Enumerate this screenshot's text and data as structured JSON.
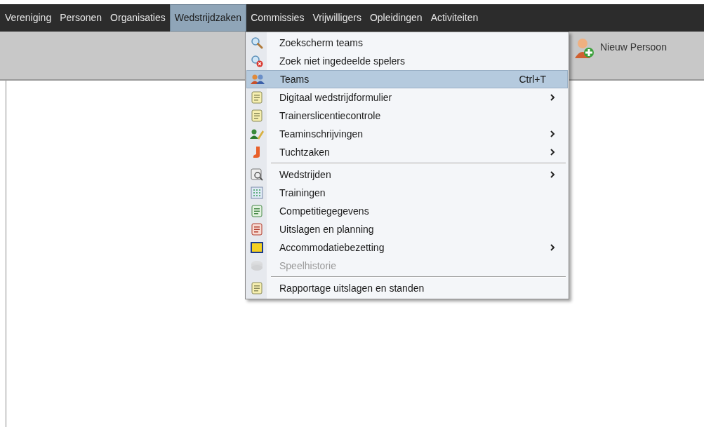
{
  "menu_bar": [
    {
      "label": "Vereniging",
      "selected": false
    },
    {
      "label": "Personen",
      "selected": false
    },
    {
      "label": "Organisaties",
      "selected": false
    },
    {
      "label": "Wedstrijdzaken",
      "selected": true
    },
    {
      "label": "Commissies",
      "selected": false
    },
    {
      "label": "Vrijwilligers",
      "selected": false
    },
    {
      "label": "Opleidingen",
      "selected": false
    },
    {
      "label": "Activiteiten",
      "selected": false
    }
  ],
  "toolbar": {
    "new_person_button": "Nieuw Persoon"
  },
  "dropdown": [
    {
      "kind": "item",
      "label": "Zoekscherm teams",
      "selected": false,
      "disabled": false,
      "submenu": false
    },
    {
      "kind": "item",
      "label": "Zoek niet ingedeelde spelers",
      "selected": false,
      "disabled": false,
      "submenu": false
    },
    {
      "kind": "item",
      "label": "Teams",
      "shortcut": "Ctrl+T",
      "selected": true,
      "disabled": false,
      "submenu": false
    },
    {
      "kind": "item",
      "label": "Digitaal wedstrijdformulier",
      "selected": false,
      "disabled": false,
      "submenu": true
    },
    {
      "kind": "item",
      "label": "Trainerslicentiecontrole",
      "selected": false,
      "disabled": false,
      "submenu": false
    },
    {
      "kind": "item",
      "label": "Teaminschrijvingen",
      "selected": false,
      "disabled": false,
      "submenu": true
    },
    {
      "kind": "item",
      "label": "Tuchtzaken",
      "selected": false,
      "disabled": false,
      "submenu": true
    },
    {
      "kind": "separator"
    },
    {
      "kind": "item",
      "label": "Wedstrijden",
      "selected": false,
      "disabled": false,
      "submenu": true
    },
    {
      "kind": "item",
      "label": "Trainingen",
      "selected": false,
      "disabled": false,
      "submenu": false
    },
    {
      "kind": "item",
      "label": "Competitiegegevens",
      "selected": false,
      "disabled": false,
      "submenu": false
    },
    {
      "kind": "item",
      "label": "Uitslagen en planning",
      "selected": false,
      "disabled": false,
      "submenu": false
    },
    {
      "kind": "item",
      "label": "Accommodatiebezetting",
      "selected": false,
      "disabled": false,
      "submenu": true
    },
    {
      "kind": "item",
      "label": "Speelhistorie",
      "selected": false,
      "disabled": true,
      "submenu": false
    },
    {
      "kind": "separator"
    },
    {
      "kind": "item",
      "label": "Rapportage uitslagen en standen",
      "selected": false,
      "disabled": false,
      "submenu": false
    }
  ]
}
